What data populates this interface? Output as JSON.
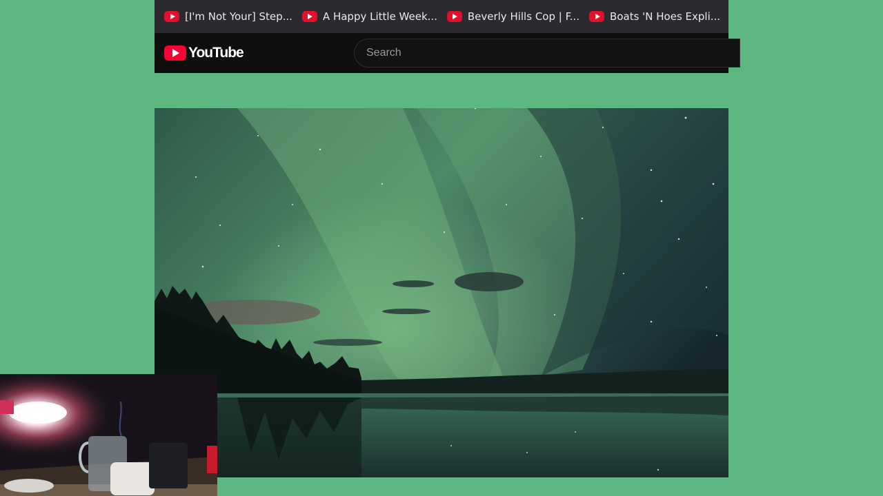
{
  "bookmarks": [
    {
      "label": "[I'm Not Your] Step...",
      "icon": "youtube-favicon"
    },
    {
      "label": "A Happy Little Week...",
      "icon": "youtube-favicon"
    },
    {
      "label": "Beverly Hills Cop | F...",
      "icon": "youtube-favicon"
    },
    {
      "label": "Boats 'N Hoes Expli...",
      "icon": "youtube-favicon"
    }
  ],
  "header": {
    "logo_text": "YouTube",
    "search_placeholder": "Search"
  },
  "colors": {
    "page_background": "#5cb783",
    "brand_red": "#ff0033",
    "header_background": "#0f0f0f",
    "tabstrip_background": "#2b2b2f"
  }
}
